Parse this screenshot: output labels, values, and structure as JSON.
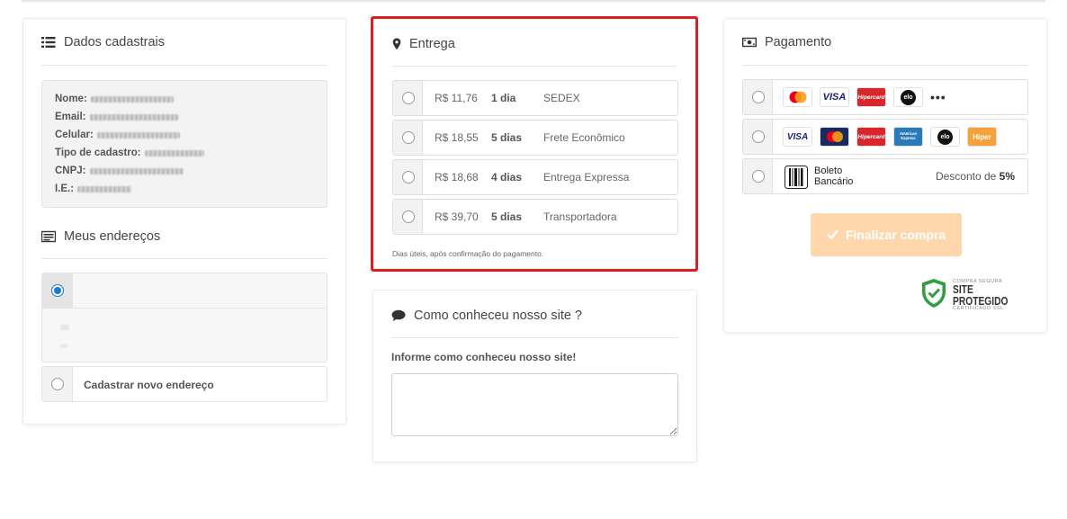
{
  "cadastrais": {
    "title": "Dados cadastrais",
    "fields": [
      {
        "label": "Nome:"
      },
      {
        "label": "Email:"
      },
      {
        "label": "Celular:"
      },
      {
        "label": "Tipo de cadastro:"
      },
      {
        "label": "CNPJ:"
      },
      {
        "label": "I.E.:"
      }
    ],
    "enderecos_title": "Meus endereços",
    "novo_endereco": "Cadastrar novo endereço"
  },
  "entrega": {
    "title": "Entrega",
    "options": [
      {
        "price": "R$ 11,76",
        "days": "1 dia",
        "name": "SEDEX"
      },
      {
        "price": "R$ 18,55",
        "days": "5 dias",
        "name": "Frete Econômico"
      },
      {
        "price": "R$ 18,68",
        "days": "4 dias",
        "name": "Entrega Expressa"
      },
      {
        "price": "R$ 39,70",
        "days": "5 dias",
        "name": "Transportadora"
      }
    ],
    "note": "Dias úteis, após confirmação do pagamento."
  },
  "como": {
    "title": "Como conheceu nosso site ?",
    "label": "Informe como conheceu nosso site!"
  },
  "pagamento": {
    "title": "Pagamento",
    "row1_cards": [
      "Mastercard",
      "VISA",
      "Hipercard",
      "elo",
      "•••"
    ],
    "row2_cards": [
      "VISA",
      "Mastercard",
      "Hipercard",
      "American Express",
      "elo",
      "Hiper"
    ],
    "boleto_line1": "Boleto",
    "boleto_line2": "Bancário",
    "desconto_prefix": "Desconto de ",
    "desconto_value": "5%",
    "button_label": "Finalizar compra",
    "seal_top": "COMPRA SEGURA",
    "seal_main": "SITE PROTEGIDO",
    "seal_bottom": "CERTIFICADO SSL"
  },
  "colors": {
    "highlight_border": "#d81f26",
    "button": "#fed7ad",
    "shield": "#2e9e3e",
    "radio_selected": "#1a7ad4"
  }
}
